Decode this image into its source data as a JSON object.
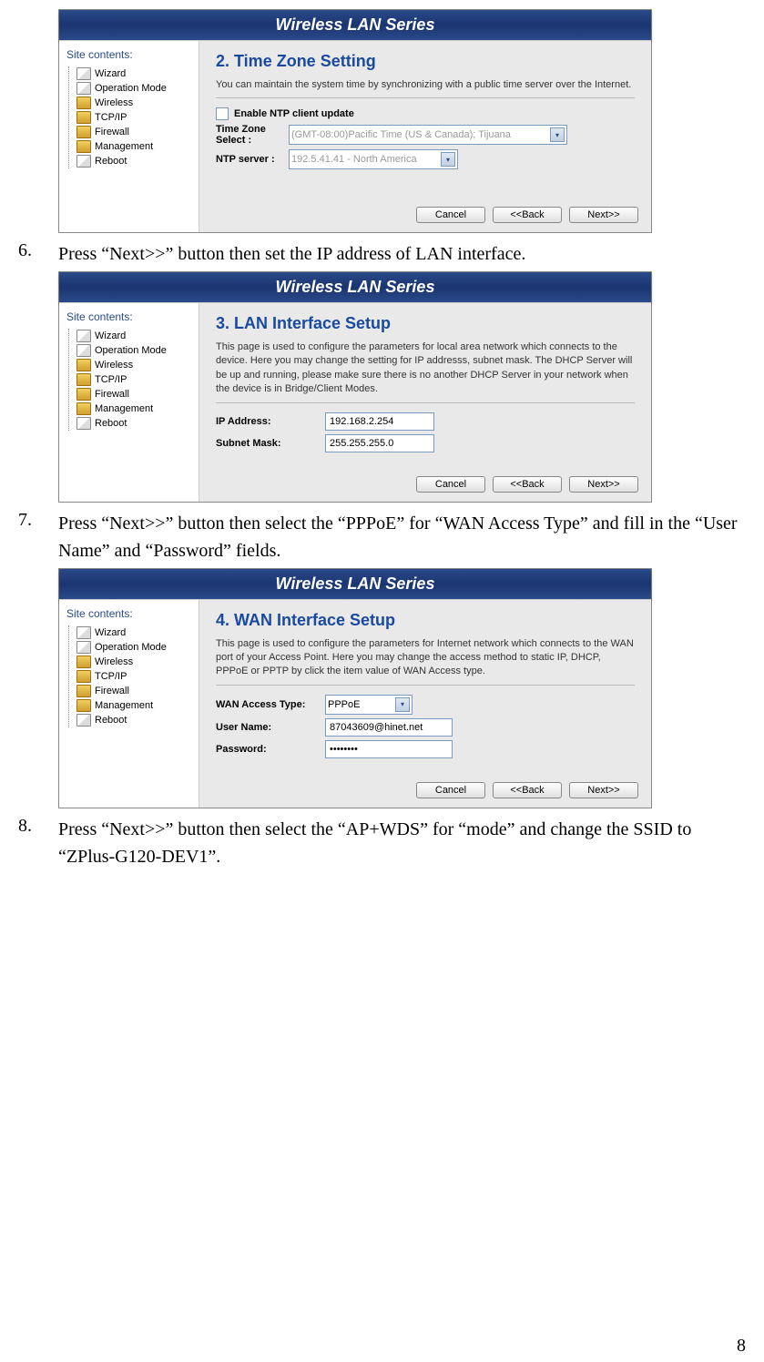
{
  "header_title": "Wireless LAN Series",
  "sidebar": {
    "title": "Site contents:",
    "items": [
      {
        "label": "Wizard",
        "icon": "page"
      },
      {
        "label": "Operation Mode",
        "icon": "page"
      },
      {
        "label": "Wireless",
        "icon": "folder"
      },
      {
        "label": "TCP/IP",
        "icon": "folder"
      },
      {
        "label": "Firewall",
        "icon": "folder"
      },
      {
        "label": "Management",
        "icon": "folder"
      },
      {
        "label": "Reboot",
        "icon": "page"
      }
    ]
  },
  "buttons": {
    "cancel": "Cancel",
    "back": "<<Back",
    "next": "Next>>"
  },
  "panel_a": {
    "title": "2. Time Zone Setting",
    "desc": "You can maintain the system time by synchronizing with a public time server over the Internet.",
    "enable_label": "Enable NTP client update",
    "tz_label": "Time Zone Select :",
    "tz_value": "(GMT-08:00)Pacific Time (US & Canada); Tijuana",
    "ntp_label": "NTP server :",
    "ntp_value": "192.5.41.41 - North America"
  },
  "step6": {
    "num": "6.",
    "text": "Press “Next>>” button then set the IP address of LAN interface."
  },
  "panel_b": {
    "title": "3. LAN Interface Setup",
    "desc": "This page is used to configure the parameters for local area network which connects to the device. Here you may change the setting for IP addresss, subnet mask. The DHCP Server will be up and running, please make sure there is no another DHCP Server in your network when the device is in Bridge/Client Modes.",
    "ip_label": "IP Address:",
    "ip_value": "192.168.2.254",
    "mask_label": "Subnet Mask:",
    "mask_value": "255.255.255.0"
  },
  "step7": {
    "num": "7.",
    "text": "Press “Next>>” button then select the “PPPoE” for “WAN Access Type” and fill in the “User Name” and “Password” fields."
  },
  "panel_c": {
    "title": "4. WAN Interface Setup",
    "desc": "This page is used to configure the parameters for Internet network which connects to the WAN port of your Access Point. Here you may change the access method to static IP, DHCP, PPPoE or PPTP by click the item value of WAN Access type.",
    "wan_label": "WAN Access Type:",
    "wan_value": "PPPoE",
    "user_label": "User Name:",
    "user_value": "87043609@hinet.net",
    "pass_label": "Password:",
    "pass_value": "••••••••"
  },
  "step8": {
    "num": "8.",
    "text": "Press “Next>>” button then select the “AP+WDS” for “mode” and change the SSID to “ZPlus-G120-DEV1”."
  },
  "page_number": "8"
}
